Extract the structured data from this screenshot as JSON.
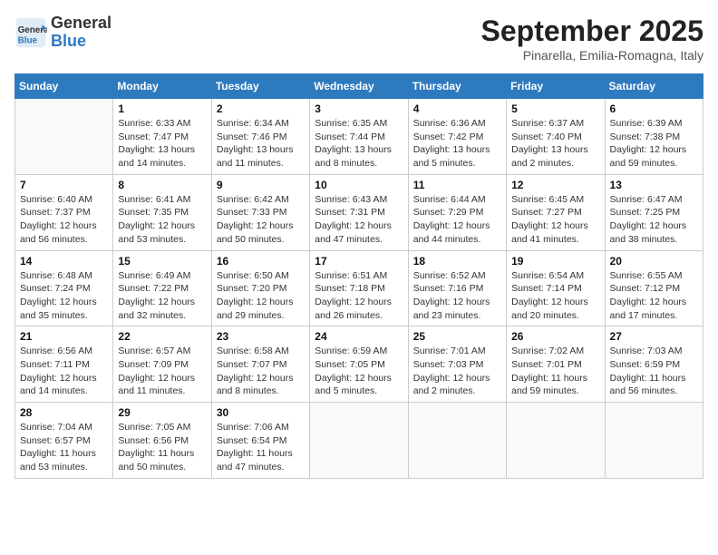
{
  "header": {
    "logo_general": "General",
    "logo_blue": "Blue",
    "month_title": "September 2025",
    "subtitle": "Pinarella, Emilia-Romagna, Italy"
  },
  "weekdays": [
    "Sunday",
    "Monday",
    "Tuesday",
    "Wednesday",
    "Thursday",
    "Friday",
    "Saturday"
  ],
  "weeks": [
    [
      {
        "day": "",
        "sunrise": "",
        "sunset": "",
        "daylight": ""
      },
      {
        "day": "1",
        "sunrise": "Sunrise: 6:33 AM",
        "sunset": "Sunset: 7:47 PM",
        "daylight": "Daylight: 13 hours and 14 minutes."
      },
      {
        "day": "2",
        "sunrise": "Sunrise: 6:34 AM",
        "sunset": "Sunset: 7:46 PM",
        "daylight": "Daylight: 13 hours and 11 minutes."
      },
      {
        "day": "3",
        "sunrise": "Sunrise: 6:35 AM",
        "sunset": "Sunset: 7:44 PM",
        "daylight": "Daylight: 13 hours and 8 minutes."
      },
      {
        "day": "4",
        "sunrise": "Sunrise: 6:36 AM",
        "sunset": "Sunset: 7:42 PM",
        "daylight": "Daylight: 13 hours and 5 minutes."
      },
      {
        "day": "5",
        "sunrise": "Sunrise: 6:37 AM",
        "sunset": "Sunset: 7:40 PM",
        "daylight": "Daylight: 13 hours and 2 minutes."
      },
      {
        "day": "6",
        "sunrise": "Sunrise: 6:39 AM",
        "sunset": "Sunset: 7:38 PM",
        "daylight": "Daylight: 12 hours and 59 minutes."
      }
    ],
    [
      {
        "day": "7",
        "sunrise": "Sunrise: 6:40 AM",
        "sunset": "Sunset: 7:37 PM",
        "daylight": "Daylight: 12 hours and 56 minutes."
      },
      {
        "day": "8",
        "sunrise": "Sunrise: 6:41 AM",
        "sunset": "Sunset: 7:35 PM",
        "daylight": "Daylight: 12 hours and 53 minutes."
      },
      {
        "day": "9",
        "sunrise": "Sunrise: 6:42 AM",
        "sunset": "Sunset: 7:33 PM",
        "daylight": "Daylight: 12 hours and 50 minutes."
      },
      {
        "day": "10",
        "sunrise": "Sunrise: 6:43 AM",
        "sunset": "Sunset: 7:31 PM",
        "daylight": "Daylight: 12 hours and 47 minutes."
      },
      {
        "day": "11",
        "sunrise": "Sunrise: 6:44 AM",
        "sunset": "Sunset: 7:29 PM",
        "daylight": "Daylight: 12 hours and 44 minutes."
      },
      {
        "day": "12",
        "sunrise": "Sunrise: 6:45 AM",
        "sunset": "Sunset: 7:27 PM",
        "daylight": "Daylight: 12 hours and 41 minutes."
      },
      {
        "day": "13",
        "sunrise": "Sunrise: 6:47 AM",
        "sunset": "Sunset: 7:25 PM",
        "daylight": "Daylight: 12 hours and 38 minutes."
      }
    ],
    [
      {
        "day": "14",
        "sunrise": "Sunrise: 6:48 AM",
        "sunset": "Sunset: 7:24 PM",
        "daylight": "Daylight: 12 hours and 35 minutes."
      },
      {
        "day": "15",
        "sunrise": "Sunrise: 6:49 AM",
        "sunset": "Sunset: 7:22 PM",
        "daylight": "Daylight: 12 hours and 32 minutes."
      },
      {
        "day": "16",
        "sunrise": "Sunrise: 6:50 AM",
        "sunset": "Sunset: 7:20 PM",
        "daylight": "Daylight: 12 hours and 29 minutes."
      },
      {
        "day": "17",
        "sunrise": "Sunrise: 6:51 AM",
        "sunset": "Sunset: 7:18 PM",
        "daylight": "Daylight: 12 hours and 26 minutes."
      },
      {
        "day": "18",
        "sunrise": "Sunrise: 6:52 AM",
        "sunset": "Sunset: 7:16 PM",
        "daylight": "Daylight: 12 hours and 23 minutes."
      },
      {
        "day": "19",
        "sunrise": "Sunrise: 6:54 AM",
        "sunset": "Sunset: 7:14 PM",
        "daylight": "Daylight: 12 hours and 20 minutes."
      },
      {
        "day": "20",
        "sunrise": "Sunrise: 6:55 AM",
        "sunset": "Sunset: 7:12 PM",
        "daylight": "Daylight: 12 hours and 17 minutes."
      }
    ],
    [
      {
        "day": "21",
        "sunrise": "Sunrise: 6:56 AM",
        "sunset": "Sunset: 7:11 PM",
        "daylight": "Daylight: 12 hours and 14 minutes."
      },
      {
        "day": "22",
        "sunrise": "Sunrise: 6:57 AM",
        "sunset": "Sunset: 7:09 PM",
        "daylight": "Daylight: 12 hours and 11 minutes."
      },
      {
        "day": "23",
        "sunrise": "Sunrise: 6:58 AM",
        "sunset": "Sunset: 7:07 PM",
        "daylight": "Daylight: 12 hours and 8 minutes."
      },
      {
        "day": "24",
        "sunrise": "Sunrise: 6:59 AM",
        "sunset": "Sunset: 7:05 PM",
        "daylight": "Daylight: 12 hours and 5 minutes."
      },
      {
        "day": "25",
        "sunrise": "Sunrise: 7:01 AM",
        "sunset": "Sunset: 7:03 PM",
        "daylight": "Daylight: 12 hours and 2 minutes."
      },
      {
        "day": "26",
        "sunrise": "Sunrise: 7:02 AM",
        "sunset": "Sunset: 7:01 PM",
        "daylight": "Daylight: 11 hours and 59 minutes."
      },
      {
        "day": "27",
        "sunrise": "Sunrise: 7:03 AM",
        "sunset": "Sunset: 6:59 PM",
        "daylight": "Daylight: 11 hours and 56 minutes."
      }
    ],
    [
      {
        "day": "28",
        "sunrise": "Sunrise: 7:04 AM",
        "sunset": "Sunset: 6:57 PM",
        "daylight": "Daylight: 11 hours and 53 minutes."
      },
      {
        "day": "29",
        "sunrise": "Sunrise: 7:05 AM",
        "sunset": "Sunset: 6:56 PM",
        "daylight": "Daylight: 11 hours and 50 minutes."
      },
      {
        "day": "30",
        "sunrise": "Sunrise: 7:06 AM",
        "sunset": "Sunset: 6:54 PM",
        "daylight": "Daylight: 11 hours and 47 minutes."
      },
      {
        "day": "",
        "sunrise": "",
        "sunset": "",
        "daylight": ""
      },
      {
        "day": "",
        "sunrise": "",
        "sunset": "",
        "daylight": ""
      },
      {
        "day": "",
        "sunrise": "",
        "sunset": "",
        "daylight": ""
      },
      {
        "day": "",
        "sunrise": "",
        "sunset": "",
        "daylight": ""
      }
    ]
  ]
}
